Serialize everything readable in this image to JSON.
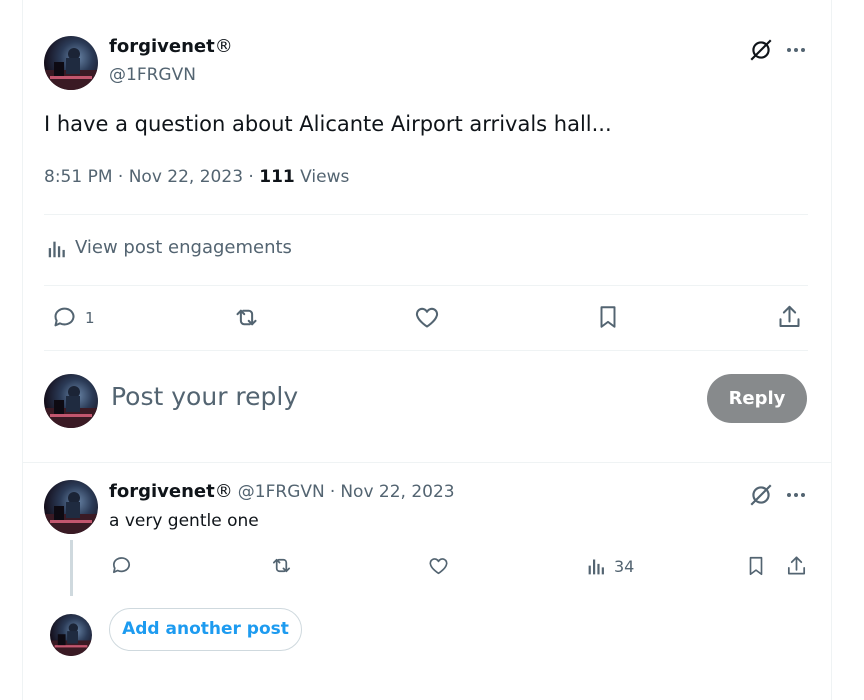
{
  "post": {
    "author_name": "forgivenet",
    "author_badge": "®",
    "handle": "@1FRGVN",
    "text": "I have a question about Alicante Airport arrivals hall...",
    "time": "8:51 PM",
    "date": "Nov 22, 2023",
    "views_count": "111",
    "views_label": "Views",
    "engagements_label": "View post engagements",
    "reply_count": "1"
  },
  "composer": {
    "placeholder": "Post your reply",
    "reply_button": "Reply"
  },
  "reply_post": {
    "author_name": "forgivenet",
    "author_badge": "®",
    "handle": "@1FRGVN",
    "separator": "·",
    "date": "Nov 22, 2023",
    "text": "a very gentle one",
    "views_count": "34"
  },
  "add_post_label": "Add another post",
  "colors": {
    "accent": "#1d9bf0",
    "secondary_text": "#536471",
    "reply_button_bg": "#878a8c"
  },
  "icons": [
    "grok-icon",
    "more-icon",
    "analytics-icon",
    "reply-icon",
    "repost-icon",
    "like-icon",
    "bookmark-icon",
    "share-icon"
  ]
}
